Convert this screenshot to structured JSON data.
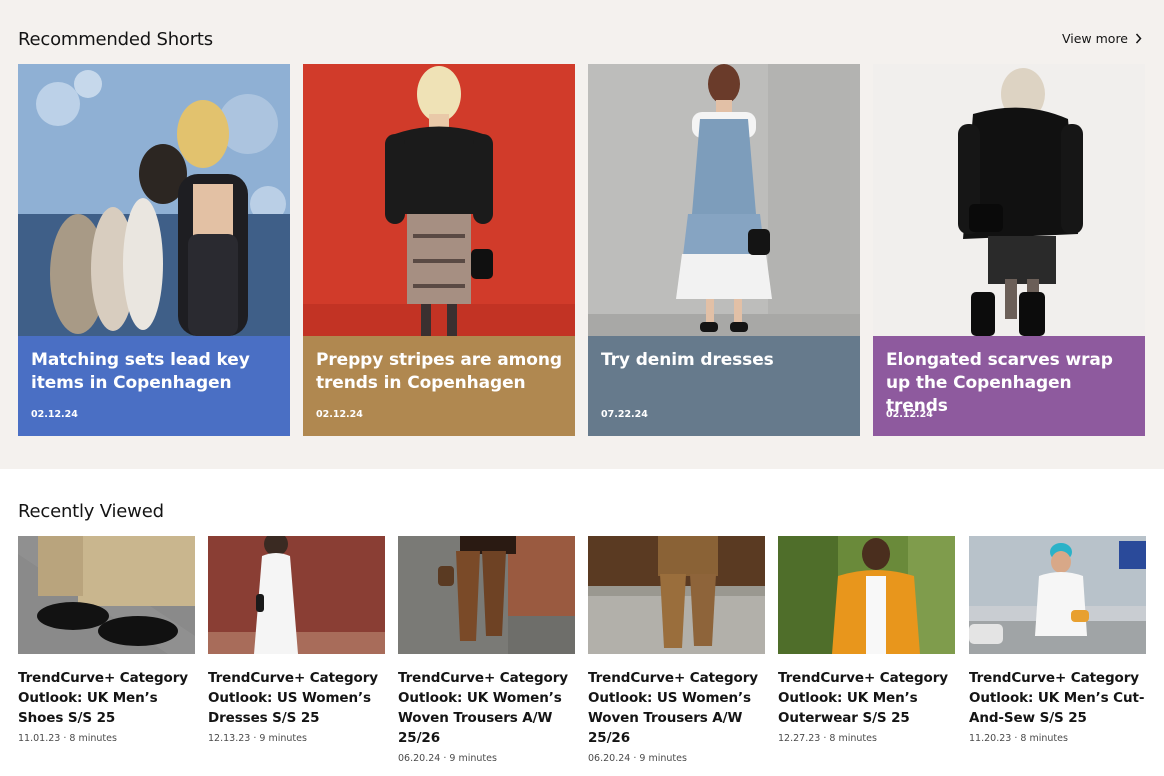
{
  "recommended": {
    "title": "Recommended Shorts",
    "view_more": "View more",
    "cards": [
      {
        "title": "Matching sets lead key items in Copenhagen",
        "date": "02.12.24",
        "panel_color": "#4a6fc4"
      },
      {
        "title": "Preppy stripes are among trends in Copenhagen",
        "date": "02.12.24",
        "panel_color": "#b08850"
      },
      {
        "title": "Try denim dresses",
        "date": "07.22.24",
        "panel_color": "#667a8c"
      },
      {
        "title": "Elongated scarves wrap up the Copenhagen trends",
        "date": "02.12.24",
        "panel_color": "#8e5a9e"
      }
    ]
  },
  "recent": {
    "title": "Recently Viewed",
    "items": [
      {
        "name": "TrendCurve+ Category Outlook: UK Men’s Shoes S/S 25",
        "date": "11.01.23",
        "read": "8 minutes"
      },
      {
        "name": "TrendCurve+ Category Outlook: US Women’s Dresses S/S 25",
        "date": "12.13.23",
        "read": "9 minutes"
      },
      {
        "name": "TrendCurve+ Category Outlook: UK Women’s Woven Trousers A/W 25/26",
        "date": "06.20.24",
        "read": "9 minutes"
      },
      {
        "name": "TrendCurve+ Category Outlook: US Women’s Woven Trousers A/W 25/26",
        "date": "06.20.24",
        "read": "9 minutes"
      },
      {
        "name": "TrendCurve+ Category Outlook: UK Men’s Outerwear S/S 25",
        "date": "12.27.23",
        "read": "8 minutes"
      },
      {
        "name": "TrendCurve+ Category Outlook: UK Men’s Cut-And-Sew S/S 25",
        "date": "11.20.23",
        "read": "8 minutes"
      }
    ]
  }
}
